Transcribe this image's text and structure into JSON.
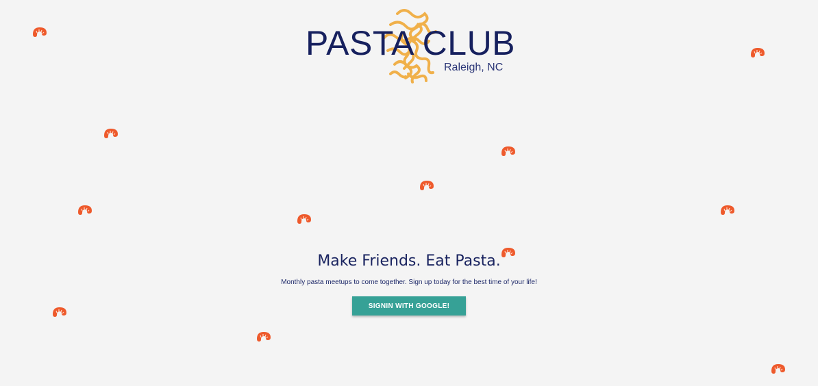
{
  "logo": {
    "title": "PASTA CLUB",
    "subtitle": "Raleigh, NC"
  },
  "hero": {
    "headline": "Make Friends. Eat Pasta.",
    "tagline": "Monthly pasta meetups to come together. Sign up today for the best time of your life!",
    "signin_label": "SIGNIN WITH GOOGLE!"
  },
  "decorations": {
    "icon": "macaroni-icon",
    "count": 14
  },
  "colors": {
    "background": "#f4f4f4",
    "brand_navy": "#16205e",
    "pasta_yellow": "#f0b04a",
    "macaroni_orange": "#ee5a2c",
    "button_teal": "#36a196"
  }
}
